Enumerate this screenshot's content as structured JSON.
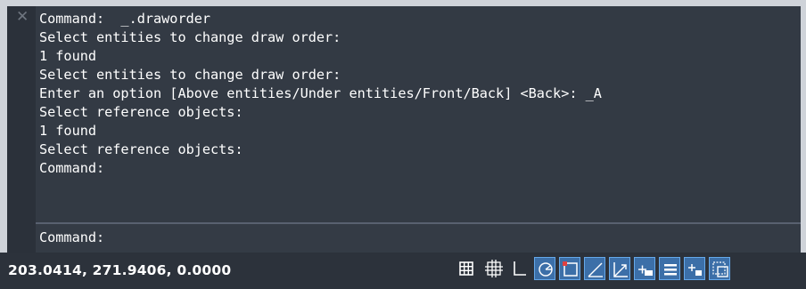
{
  "window": {
    "close_glyph": "✕",
    "history": [
      "Command:  _.draworder",
      "Select entities to change draw order:",
      "1 found",
      "Select entities to change draw order:",
      "Enter an option [Above entities/Under entities/Front/Back] <Back>: _A",
      "Select reference objects:",
      "1 found",
      "Select reference objects:",
      "Command:"
    ],
    "prompt": "Command:"
  },
  "statusbar": {
    "coordinates": "203.0414, 271.9406, 0.0000",
    "toggles": [
      {
        "icon": "grid-display-icon",
        "on": false
      },
      {
        "icon": "snap-mode-icon",
        "on": false
      },
      {
        "icon": "ortho-mode-icon",
        "on": false
      },
      {
        "icon": "polar-tracking-icon",
        "on": true
      },
      {
        "icon": "object-snap-icon",
        "on": true
      },
      {
        "icon": "object-snap-tracking-icon",
        "on": true
      },
      {
        "icon": "dynamic-ucs-icon",
        "on": true
      },
      {
        "icon": "dynamic-input-icon",
        "on": true
      },
      {
        "icon": "lineweight-icon",
        "on": true
      },
      {
        "icon": "quick-properties-icon",
        "on": true
      },
      {
        "icon": "selection-cycling-icon",
        "on": true
      }
    ],
    "colors": {
      "active_bg": "#3c6fa8",
      "active_border": "#64a8ea",
      "icon": "#ffffff"
    }
  }
}
